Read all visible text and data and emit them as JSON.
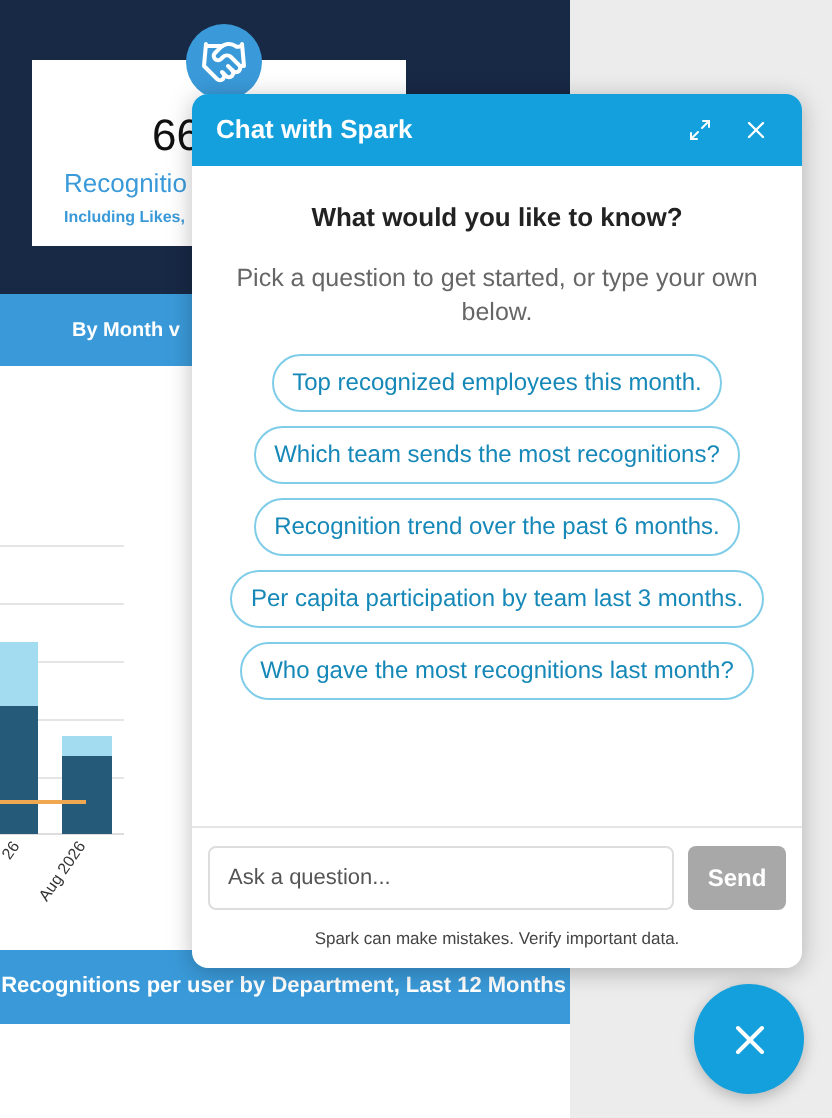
{
  "dashboard": {
    "stat_card": {
      "value": "66",
      "label": "Recognitio",
      "sublabel": "Including Likes,"
    },
    "section_1_title": "By Month v",
    "chart": {
      "x_labels": [
        "26",
        "Aug 2026"
      ]
    },
    "section_2_title": "Recognitions per user by Department, Last 12 Months"
  },
  "chat": {
    "title": "Chat with Spark",
    "heading": "What would you like to know?",
    "intro": "Pick a question to get started, or type your own below.",
    "suggestions": [
      "Top recognized employees this month.",
      "Which team sends the most recognitions?",
      "Recognition trend over the past 6 months.",
      "Per capita participation by team last 3 months.",
      "Who gave the most recognitions last month?"
    ],
    "input": {
      "placeholder": "Ask a question..."
    },
    "send_button": {
      "label": "Send",
      "disabled": true
    },
    "disclaimer": "Spark can make mistakes. Verify important data."
  }
}
